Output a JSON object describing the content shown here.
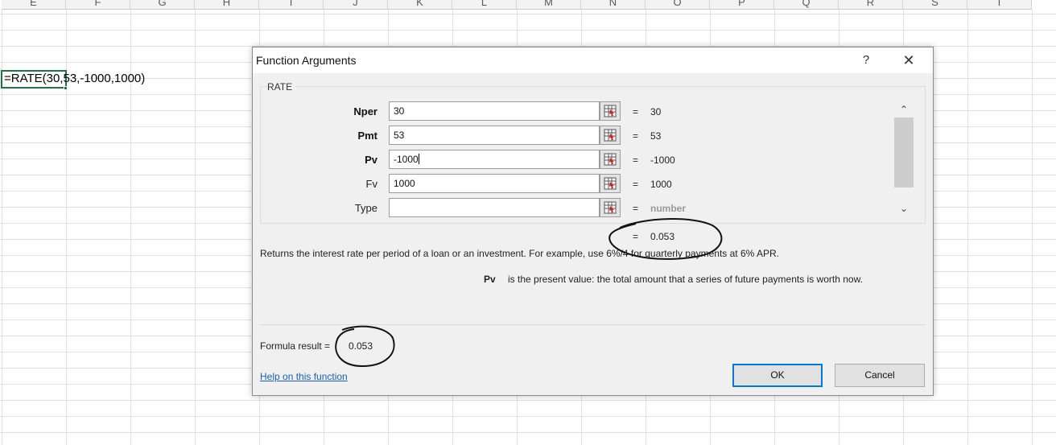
{
  "sheet": {
    "columns": [
      "E",
      "F",
      "G",
      "H",
      "I",
      "J",
      "K",
      "L",
      "M",
      "N",
      "O",
      "P",
      "Q",
      "R",
      "S",
      "T"
    ],
    "active_cell_formula": "=RATE(30,53,-1000,1000)"
  },
  "dialog": {
    "title": "Function Arguments",
    "help_label": "?",
    "close_label": "✕",
    "function_name": "RATE",
    "args": [
      {
        "label": "Nper",
        "value": "30",
        "result": "30"
      },
      {
        "label": "Pmt",
        "value": "53",
        "result": "53"
      },
      {
        "label": "Pv",
        "value": "-1000",
        "result": "-1000"
      },
      {
        "label": "Fv",
        "value": "1000",
        "result": "1000"
      },
      {
        "label": "Type",
        "value": "",
        "result": "number"
      }
    ],
    "equals": "=",
    "function_result": "0.053",
    "description": "Returns the interest rate per period of a loan or an investment. For example, use 6%/4 for quarterly payments at 6% APR.",
    "current_arg_name": "Pv",
    "current_arg_description": "is the present value: the total amount that a series of future payments is worth now.",
    "formula_result_label": "Formula result =",
    "formula_result_value": "0.053",
    "help_link": "Help on this function",
    "ok_label": "OK",
    "cancel_label": "Cancel",
    "scroll_up_icon": "chevron-up-icon",
    "scroll_down_icon": "chevron-down-icon"
  },
  "colors": {
    "excel_green": "#217346",
    "link_blue": "#1a5fb4",
    "default_button_border": "#0078d7",
    "dialog_bg": "#f0f0f0"
  }
}
